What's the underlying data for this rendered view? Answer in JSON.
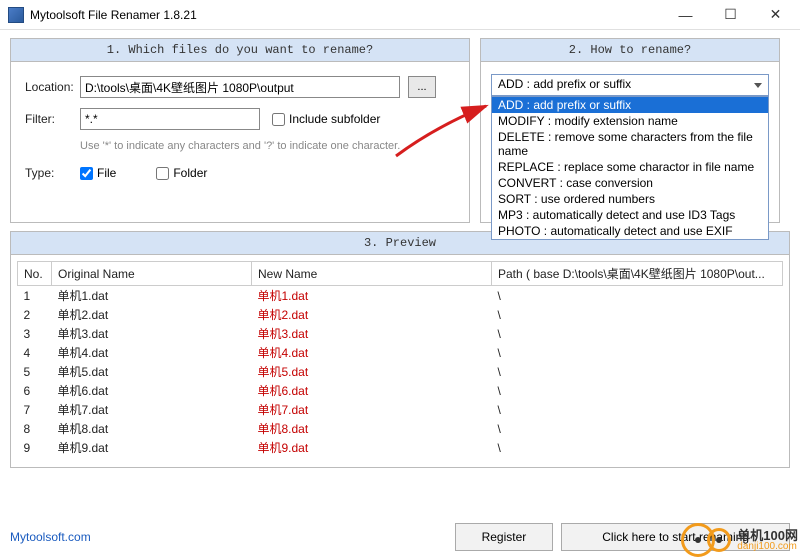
{
  "window": {
    "title": "Mytoolsoft File Renamer 1.8.21"
  },
  "panel1": {
    "header": "1. Which files do you want to rename?",
    "location_label": "Location:",
    "location_value": "D:\\tools\\桌面\\4K壁纸图片 1080P\\output",
    "browse_label": "...",
    "filter_label": "Filter:",
    "filter_value": "*.*",
    "include_subfolder_label": "Include subfolder",
    "hint": "Use '*' to indicate any characters and '?' to indicate one character.",
    "type_label": "Type:",
    "file_label": "File",
    "folder_label": "Folder"
  },
  "panel2": {
    "header": "2. How to rename?",
    "selected": "ADD : add prefix or suffix",
    "options": [
      "ADD : add prefix or suffix",
      "MODIFY : modify extension name",
      "DELETE : remove some characters from the file name",
      "REPLACE : replace some charactor in file name",
      "CONVERT : case conversion",
      "SORT : use ordered numbers",
      "MP3 : automatically detect and use ID3 Tags",
      "PHOTO : automatically detect and use EXIF"
    ]
  },
  "preview": {
    "header": "3. Preview",
    "columns": {
      "no": "No.",
      "original": "Original Name",
      "newname": "New Name",
      "path": "Path ( base D:\\tools\\桌面\\4K壁纸图片 1080P\\out..."
    },
    "rows": [
      {
        "no": "1",
        "orig": "单机1.dat",
        "new": "单机1.dat",
        "path": "\\"
      },
      {
        "no": "2",
        "orig": "单机2.dat",
        "new": "单机2.dat",
        "path": "\\"
      },
      {
        "no": "3",
        "orig": "单机3.dat",
        "new": "单机3.dat",
        "path": "\\"
      },
      {
        "no": "4",
        "orig": "单机4.dat",
        "new": "单机4.dat",
        "path": "\\"
      },
      {
        "no": "5",
        "orig": "单机5.dat",
        "new": "单机5.dat",
        "path": "\\"
      },
      {
        "no": "6",
        "orig": "单机6.dat",
        "new": "单机6.dat",
        "path": "\\"
      },
      {
        "no": "7",
        "orig": "单机7.dat",
        "new": "单机7.dat",
        "path": "\\"
      },
      {
        "no": "8",
        "orig": "单机8.dat",
        "new": "单机8.dat",
        "path": "\\"
      },
      {
        "no": "9",
        "orig": "单机9.dat",
        "new": "单机9.dat",
        "path": "\\"
      }
    ]
  },
  "footer": {
    "link": "Mytoolsoft.com",
    "register": "Register",
    "start": "Click here to start renaming"
  },
  "watermark": {
    "cn": "单机100网",
    "en": "danji100.com"
  }
}
